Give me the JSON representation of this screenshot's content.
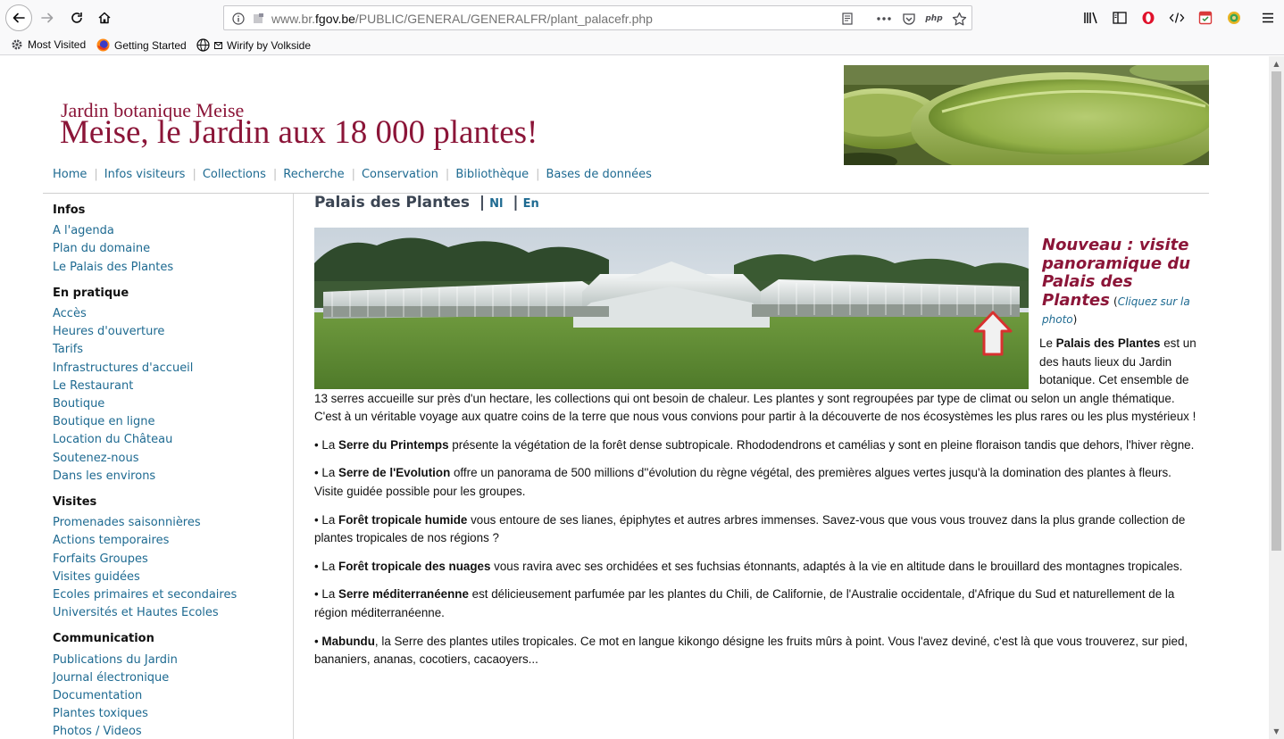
{
  "browser": {
    "url_prefix": "www.br.",
    "url_host": "fgov.be",
    "url_path": "/PUBLIC/GENERAL/GENERALFR/plant_palacefr.php",
    "bookmarks": [
      "Most Visited",
      "Getting Started",
      "Wirify by Volkside"
    ]
  },
  "site": {
    "subtitle": "Jardin botanique Meise",
    "title": "Meise, le Jardin aux 18 000 plantes!"
  },
  "topnav": [
    "Home",
    "Infos visiteurs",
    "Collections",
    "Recherche",
    "Conservation",
    "Bibliothèque",
    "Bases de données"
  ],
  "sidebar": {
    "sections": [
      {
        "heading": "Infos",
        "links": [
          "A l'agenda",
          "Plan du domaine",
          "Le Palais des Plantes"
        ]
      },
      {
        "heading": "En pratique",
        "links": [
          "Accès",
          "Heures d'ouverture",
          "Tarifs",
          "Infrastructures d'accueil",
          "Le Restaurant",
          "Boutique",
          "Boutique en ligne",
          "Location du Château",
          "Soutenez-nous",
          "Dans les environs"
        ]
      },
      {
        "heading": "Visites",
        "links": [
          "Promenades saisonnières",
          "Actions temporaires",
          "Forfaits Groupes",
          "Visites guidées",
          "Ecoles primaires et secondaires",
          "Universités et Hautes Ecoles"
        ]
      },
      {
        "heading": "Communication",
        "links": [
          "Publications du Jardin",
          "Journal électronique",
          "Documentation",
          "Plantes toxiques",
          "Photos / Videos"
        ]
      }
    ]
  },
  "content": {
    "title": "Palais des Plantes",
    "lang_nl": "Nl",
    "lang_en": "En",
    "aside_title": "Nouveau : visite panoramique du Palais des Plantes",
    "aside_open": "(",
    "aside_link": "Cliquez sur la photo",
    "aside_close": ")",
    "intro_pre": "Le ",
    "intro_bold": "Palais des Plantes",
    "intro_rest": " est un des hauts lieux du Jardin botanique. Cet ensemble de 13 serres accueille sur près d'un hectare, les collections qui ont besoin de chaleur. Les plantes y sont regroupées par type de climat ou selon un angle thématique. C'est à un véritable voyage aux quatre coins de la terre que nous vous convions pour partir à la découverte de nos écosystèmes les plus rares ou les plus mystérieux !",
    "bullets": [
      {
        "pre": "• La ",
        "bold": "Serre du Printemps",
        "rest": " présente la végétation de la forêt dense subtropicale. Rhododendrons et camélias y sont en pleine floraison tandis que dehors, l'hiver règne."
      },
      {
        "pre": "• La ",
        "bold": "Serre de l'Evolution",
        "rest": " offre un panorama de 500 millions d''évolution du règne végétal, des premières algues vertes jusqu'à la domination des plantes à fleurs. Visite guidée possible pour les groupes."
      },
      {
        "pre": "• La ",
        "bold": "Forêt tropicale humide",
        "rest": " vous entoure de ses lianes, épiphytes et autres arbres immenses. Savez-vous que vous vous trouvez dans la plus grande collection de plantes tropicales de nos régions ?"
      },
      {
        "pre": "• La ",
        "bold": "Forêt tropicale des nuages",
        "rest": " vous ravira avec ses orchidées et ses fuchsias étonnants, adaptés à la vie en altitude dans le brouillard des montagnes tropicales."
      },
      {
        "pre": "• La ",
        "bold": "Serre méditerranéenne",
        "rest": " est délicieusement parfumée par les plantes du Chili, de Californie, de l'Australie occidentale, d'Afrique du Sud et naturellement de la région méditerranéenne."
      },
      {
        "pre": "• ",
        "bold": "Mabundu",
        "rest": ", la Serre des plantes utiles tropicales. Ce mot en langue kikongo désigne les fruits mûrs à point. Vous l'avez deviné, c'est là que vous trouverez, sur pied, bananiers, ananas, cocotiers, cacaoyers..."
      }
    ]
  },
  "colors": {
    "brand": "#8b1538",
    "link": "#1e6a91"
  }
}
